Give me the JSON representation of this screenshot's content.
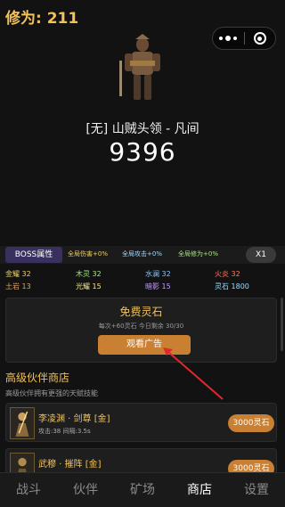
{
  "header": {
    "xiuwei": "修为: 211"
  },
  "boss": {
    "name": "[无] 山贼头领 - 凡间",
    "hp": "9396"
  },
  "attr_bar": {
    "tab_label": "BOSS属性",
    "buffs": [
      "全局伤害+0%",
      "全局攻击+0%",
      "全局修为+0%"
    ],
    "speed": "X1"
  },
  "stats": [
    {
      "label": "金耀 32",
      "color": "#f0d060"
    },
    {
      "label": "木灵 32",
      "color": "#a6e87f"
    },
    {
      "label": "水澜 32",
      "color": "#7fc4ff"
    },
    {
      "label": "火炎 32",
      "color": "#ff7b5a"
    },
    {
      "label": "土岩 13",
      "color": "#d6a76b"
    },
    {
      "label": "光耀 15",
      "color": "#f5e690"
    },
    {
      "label": "暗影 15",
      "color": "#c49bff"
    },
    {
      "label": "灵石 1800",
      "color": "#9fdcff"
    }
  ],
  "free_stone": {
    "title": "免费灵石",
    "subtitle": "每次+60灵石  今日剩余 30/30",
    "button": "观看广告"
  },
  "shop": {
    "title": "高级伙伴商店",
    "desc": "高级伙伴拥有更强的天赋技能",
    "items": [
      {
        "name": "李凌渊 · 剑尊 [金]",
        "stats": "攻击:38   间隔:3.5s",
        "price": "3000灵石"
      },
      {
        "name": "武穆 · 摧阵 [金]",
        "stats": "",
        "price": "3000灵石"
      }
    ]
  },
  "nav": [
    "战斗",
    "伙伴",
    "矿场",
    "商店",
    "设置"
  ],
  "colors": {
    "accent": "#c98032",
    "gold": "#f1c15a"
  }
}
